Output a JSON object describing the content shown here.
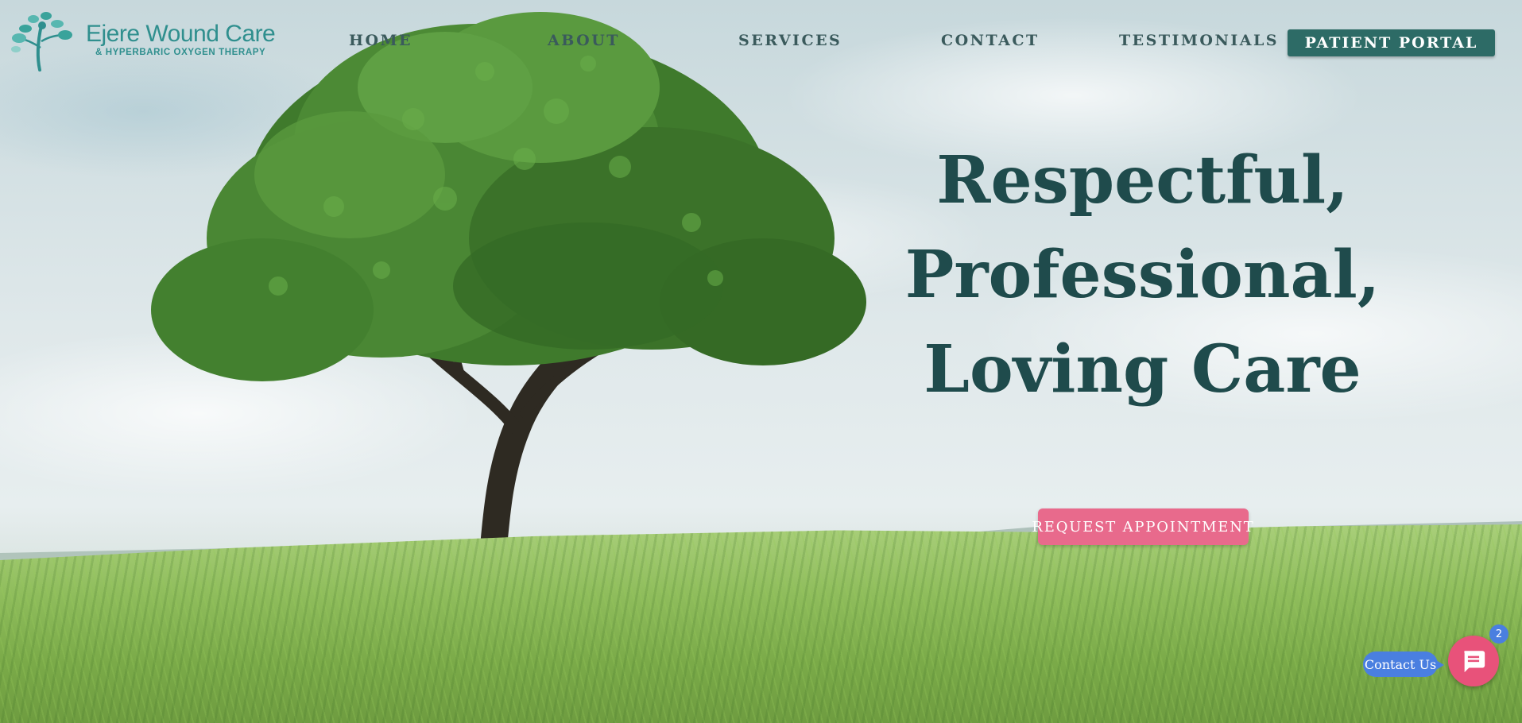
{
  "colors": {
    "brand_teal": "#2f8f8e",
    "nav_text": "#3a5a5c",
    "portal_bg": "#2d6b66",
    "hero_text": "#1f4b4c",
    "cta_bg": "#e86a8c",
    "chat_label_bg": "#4a7fe0",
    "chat_button_bg": "#e8527a"
  },
  "logo": {
    "title": "Ejere Wound Care",
    "subtitle": "& HYPERBARIC OXYGEN THERAPY",
    "icon": "tree-figure-icon"
  },
  "nav": {
    "items": [
      "HOME",
      "ABOUT",
      "SERVICES",
      "CONTACT",
      "TESTIMONIALS"
    ],
    "portal_label": "PATIENT PORTAL"
  },
  "hero": {
    "lines": [
      "Respectful,",
      "Professional,",
      "Loving Care"
    ],
    "cta_label": "REQUEST APPOINTMENT"
  },
  "chat": {
    "label": "Contact Us",
    "badge_count": "2",
    "icon": "chat-bubble-icon"
  }
}
